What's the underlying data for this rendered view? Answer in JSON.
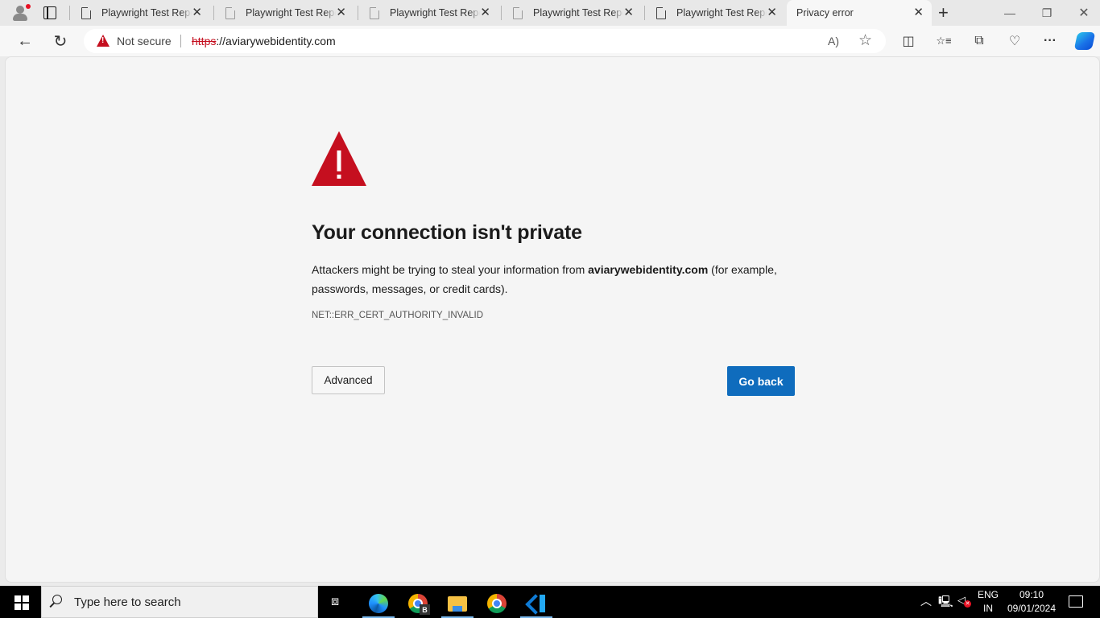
{
  "browser": {
    "tabs": [
      {
        "title": "Playwright Test Report",
        "active": false
      },
      {
        "title": "Playwright Test Report",
        "active": false
      },
      {
        "title": "Playwright Test Report",
        "active": false
      },
      {
        "title": "Playwright Test Report",
        "active": false
      },
      {
        "title": "Playwright Test Report",
        "active": false
      },
      {
        "title": "Privacy error",
        "active": true
      }
    ],
    "new_tab_label": "+",
    "window_controls": {
      "minimize": "—",
      "restore": "❐",
      "close": "✕"
    },
    "toolbar": {
      "back_icon": "←",
      "refresh_icon": "↻",
      "security_label": "Not secure",
      "url_scheme": "https",
      "url_rest": "://aviarywebidentity.com",
      "read_aloud_icon": "A)",
      "favorite_icon": "☆",
      "split_screen_icon": "◫",
      "favorites_icon": "☆≡",
      "collections_icon": "⧉",
      "browser_essentials_icon": "♡",
      "more_icon": "···"
    }
  },
  "page": {
    "heading": "Your connection isn't private",
    "desc_prefix": "Attackers might be trying to steal your information from ",
    "desc_domain": "aviarywebidentity.com",
    "desc_suffix": " (for example, passwords, messages, or credit cards).",
    "error_code": "NET::ERR_CERT_AUTHORITY_INVALID",
    "advanced_label": "Advanced",
    "go_back_label": "Go back",
    "colors": {
      "warning": "#c50f1f",
      "primary": "#0f6cbd"
    }
  },
  "taskbar": {
    "search_placeholder": "Type here to search",
    "apps": [
      "task-view",
      "edge",
      "chrome-profile-b",
      "file-explorer",
      "chrome",
      "vscode"
    ],
    "chrome_badge": "B",
    "tray": {
      "chevron": "^",
      "lang_line1": "ENG",
      "lang_line2": "IN",
      "time": "09:10",
      "date": "09/01/2024"
    }
  }
}
